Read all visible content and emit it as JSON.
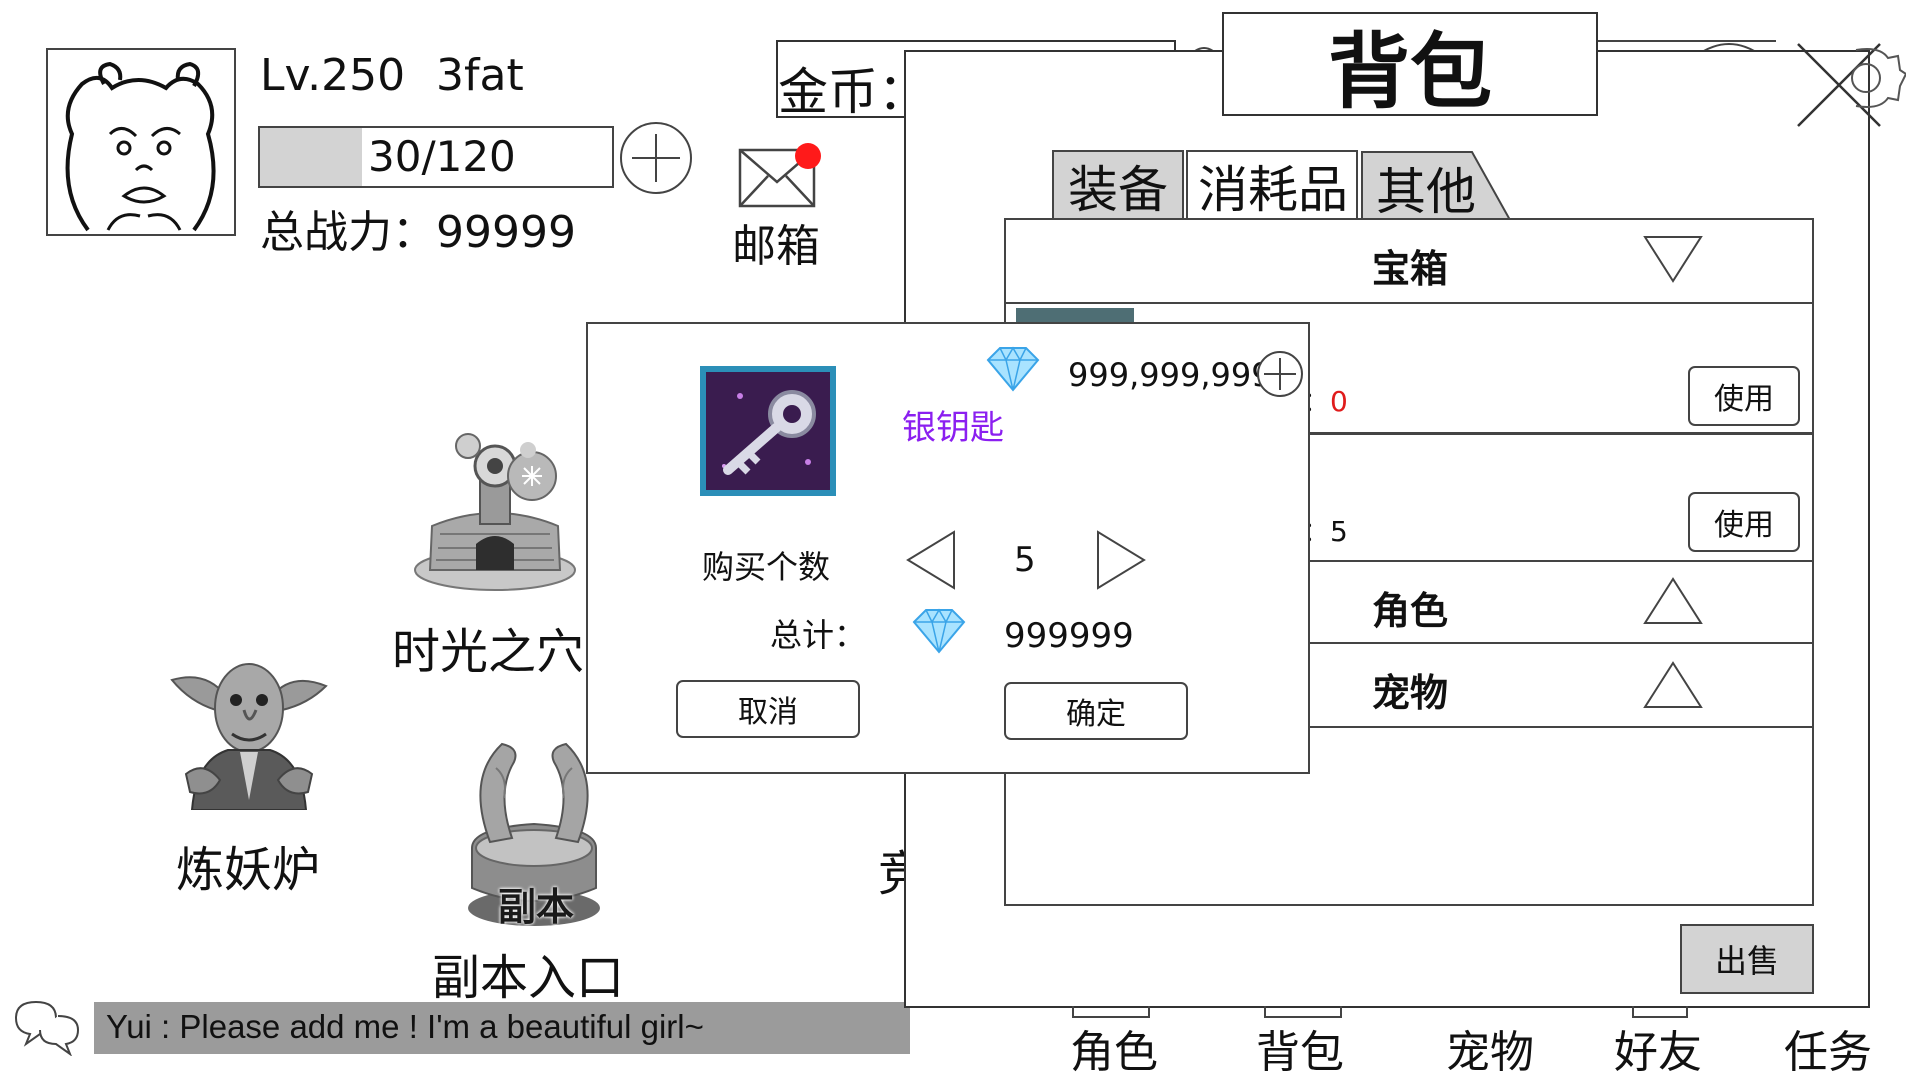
{
  "player": {
    "level": "Lv.250",
    "name": "3fat",
    "stamina": "30/120",
    "stamina_fill": 0.29,
    "power": "总战力：99999"
  },
  "mail": {
    "label": "邮箱"
  },
  "currency": {
    "gold_label": "金币："
  },
  "bag": {
    "title": "背包",
    "tabs": [
      {
        "label": "装备"
      },
      {
        "label": "消耗品"
      },
      {
        "label": "其他"
      }
    ],
    "sections": {
      "chest": "宝箱",
      "role": "角色",
      "pet": "宠物"
    },
    "items": [
      {
        "count_prefix": "：",
        "count": "0",
        "use_label": "使用"
      },
      {
        "count_prefix": "：",
        "count": "5",
        "use_label": "使用"
      }
    ],
    "sell_label": "出售"
  },
  "purchase": {
    "item_name": "银钥匙",
    "balance": "999,999,999",
    "quantity_label": "购买个数",
    "quantity": "5",
    "total_label": "总计：",
    "total": "999999",
    "cancel_label": "取消",
    "confirm_label": "确定"
  },
  "buildings": {
    "time_cave": "时光之穴",
    "furnace": "炼妖炉",
    "dungeon": "副本入口",
    "dungeon_emblem": "副本"
  },
  "hidden_building_partial": "竞",
  "chat": {
    "message": "Yui : Please add me ! I'm a beautiful girl~"
  },
  "nav": [
    {
      "label": "角色"
    },
    {
      "label": "背包"
    },
    {
      "label": "宠物"
    },
    {
      "label": "好友"
    },
    {
      "label": "任务"
    }
  ],
  "colors": {
    "item_name": "#8b1ff0",
    "alert_dot": "#ff1a1a",
    "zero_count": "#e01b1b",
    "chat_bg": "#9b9b9b",
    "panel_grey": "#d3d3d3",
    "diamond": "#5fbfff"
  }
}
